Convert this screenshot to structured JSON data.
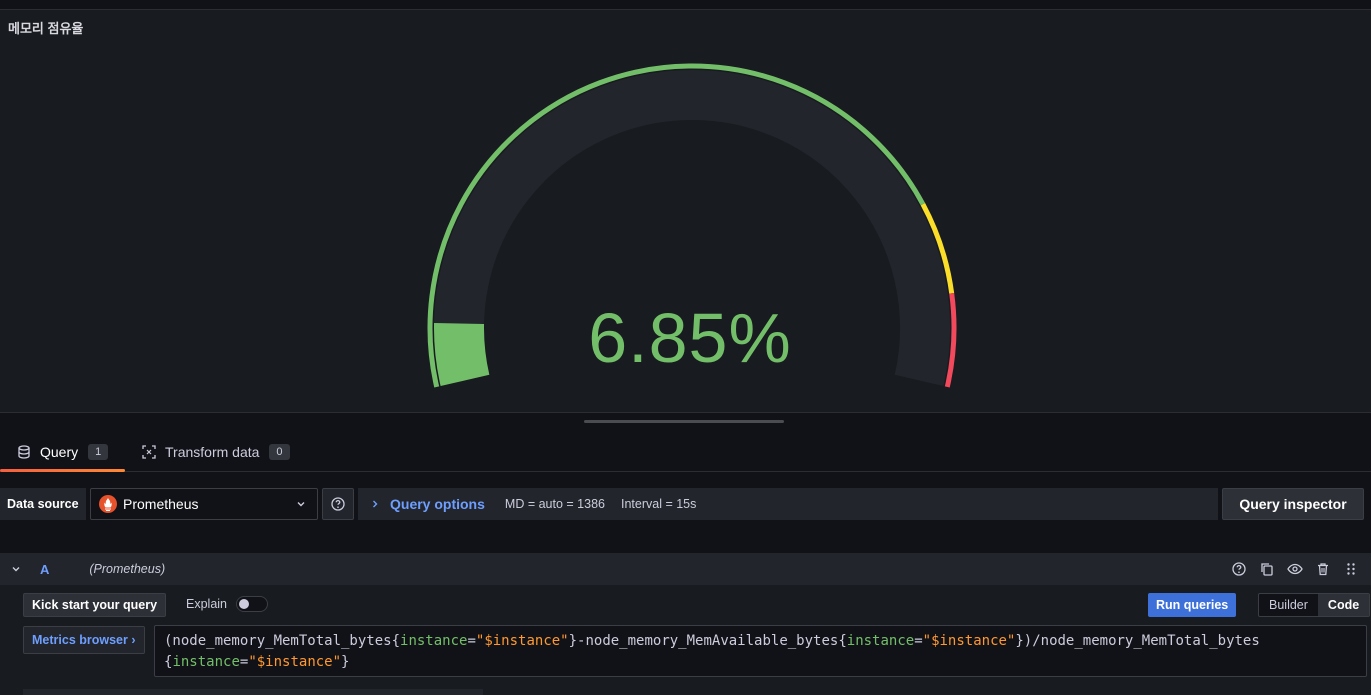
{
  "panel": {
    "title": "메모리 점유율",
    "gauge": {
      "value_text": "6.85%",
      "value": 6.85,
      "min": 0,
      "max": 100,
      "thresholds": [
        {
          "from": 0,
          "color": "#73bf69"
        },
        {
          "from": 80,
          "color": "#fade2a"
        },
        {
          "from": 90,
          "color": "#f2495c"
        }
      ],
      "value_color": "#73bf69"
    }
  },
  "tabs": [
    {
      "label": "Query",
      "count": "1",
      "icon": "database-icon",
      "active": true
    },
    {
      "label": "Transform data",
      "count": "0",
      "icon": "transform-icon",
      "active": false
    }
  ],
  "datasource": {
    "label": "Data source",
    "selected": "Prometheus",
    "help_icon": "question-circle-icon"
  },
  "query_options": {
    "title": "Query options",
    "md": "MD = auto = 1386",
    "interval": "Interval = 15s"
  },
  "query_inspector": {
    "label": "Query inspector"
  },
  "query_row": {
    "ref": "A",
    "datasource_name": "(Prometheus)"
  },
  "query_toolbar": {
    "kick_start": "Kick start your query",
    "explain": "Explain",
    "explain_on": false,
    "run": "Run queries",
    "mode_builder": "Builder",
    "mode_code": "Code",
    "metrics_browser": "Metrics browser ›"
  },
  "expr": {
    "t1": "(node_memory_MemTotal_bytes{",
    "t2": "instance",
    "t3": "=",
    "t4": "\"$instance\"",
    "t5": "}-node_memory_MemAvailable_bytes{",
    "t6": "instance",
    "t7": "=",
    "t8": "\"$instance\"",
    "t9": "})/node_memory_MemTotal_bytes",
    "t10": "{",
    "t11": "instance",
    "t12": "=",
    "t13": "\"$instance\"",
    "t14": "}"
  }
}
